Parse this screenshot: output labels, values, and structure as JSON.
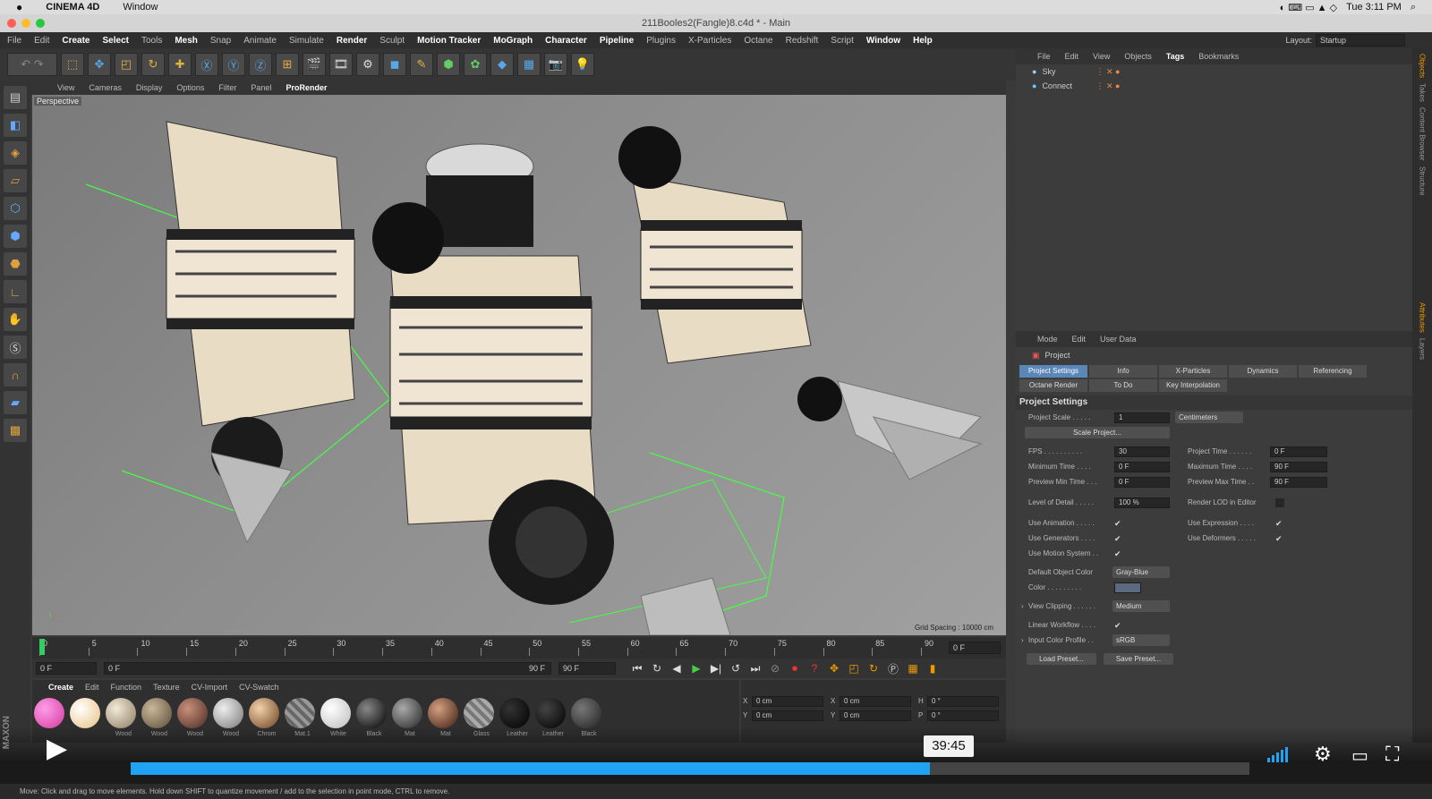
{
  "mac": {
    "apple": "",
    "app": "CINEMA 4D",
    "menu": "Window",
    "clock": "Tue 3:11 PM"
  },
  "window": {
    "title": "211Booles2(Fangle)8.c4d * - Main"
  },
  "menu": [
    "File",
    "Edit",
    "Create",
    "Select",
    "Tools",
    "Mesh",
    "Snap",
    "Animate",
    "Simulate",
    "Render",
    "Sculpt",
    "Motion Tracker",
    "MoGraph",
    "Character",
    "Pipeline",
    "Plugins",
    "X-Particles",
    "Octane",
    "Redshift",
    "Script",
    "Window",
    "Help"
  ],
  "menu_highlight": [
    "Create",
    "Select",
    "Mesh",
    "Render",
    "Motion Tracker",
    "MoGraph",
    "Character",
    "Pipeline",
    "Window",
    "Help"
  ],
  "layout": {
    "label": "Layout:",
    "value": "Startup"
  },
  "viewport": {
    "menu": [
      "View",
      "Cameras",
      "Display",
      "Options",
      "Filter",
      "Panel",
      "ProRender"
    ],
    "label": "Perspective",
    "grid_spacing": "Grid Spacing : 10000 cm"
  },
  "timeline": {
    "ticks": [
      "0",
      "5",
      "10",
      "15",
      "20",
      "25",
      "30",
      "35",
      "40",
      "45",
      "50",
      "55",
      "60",
      "65",
      "70",
      "75",
      "80",
      "85",
      "90"
    ],
    "end_field": "0 F"
  },
  "transport": {
    "start": "0 F",
    "range_start": "0 F",
    "range_end": "90 F",
    "end": "90 F"
  },
  "materials": {
    "menu": [
      "Create",
      "Edit",
      "Function",
      "Texture",
      "CV-Import",
      "CV-Swatch"
    ],
    "labels": [
      "Wood",
      "Wood",
      "Wood",
      "Wood",
      "Chrom",
      "Mat.1",
      "White",
      "Black",
      "Mat",
      "Mat",
      "Glass",
      "Leather",
      "Leather",
      "Black"
    ]
  },
  "coords": {
    "x_pos": "0 cm",
    "y_pos": "0 cm",
    "x_size": "0 cm",
    "y_size": "0 cm",
    "h_rot": "0 °",
    "p_rot": "0 °"
  },
  "objects": {
    "menu": [
      "File",
      "Edit",
      "View",
      "Objects",
      "Tags",
      "Bookmarks"
    ],
    "rows": [
      "Sky",
      "Connect"
    ]
  },
  "attributes": {
    "menu": [
      "Mode",
      "Edit",
      "User Data"
    ],
    "object": "Project",
    "tabs": [
      "Project Settings",
      "Info",
      "X-Particles",
      "Dynamics",
      "Referencing",
      "Octane Render",
      "To Do",
      "Key Interpolation"
    ],
    "section": "Project Settings",
    "project_scale_label": "Project Scale . . . . .",
    "project_scale_value": "1",
    "project_scale_unit": "Centimeters",
    "scale_project_btn": "Scale Project...",
    "fps_label": "FPS . . . . . . . . . .",
    "fps": "30",
    "project_time_label": "Project Time . . . . . .",
    "project_time": "0 F",
    "min_time_label": "Minimum Time . . . .",
    "min_time": "0 F",
    "max_time_label": "Maximum Time . . . .",
    "max_time": "90 F",
    "prev_min_label": "Preview Min Time . . .",
    "prev_min": "0 F",
    "prev_max_label": "Preview Max Time . .",
    "prev_max": "90 F",
    "lod_label": "Level of Detail . . . . .",
    "lod": "100 %",
    "render_lod_label": "Render LOD in Editor",
    "use_anim_label": "Use Animation . . . . .",
    "use_expr_label": "Use Expression . . . .",
    "use_gen_label": "Use Generators . . . .",
    "use_def_label": "Use Deformers . . . . .",
    "use_motion_label": "Use Motion System . .",
    "def_color_label": "Default Object Color",
    "def_color": "Gray-Blue",
    "color_label": "Color . . . . . . . . .",
    "view_clip_label": "View Clipping . . . . . .",
    "view_clip": "Medium",
    "linear_label": "Linear Workflow . . . .",
    "input_profile_label": "Input Color Profile . .",
    "input_profile": "sRGB",
    "load_preset": "Load Preset...",
    "save_preset": "Save Preset..."
  },
  "status": "Move: Click and drag to move elements. Hold down SHIFT to quantize movement / add to the selection in point mode, CTRL to remove.",
  "player": {
    "time": "39:45",
    "progress": 0.714
  },
  "icons": {
    "play": "play-icon",
    "volume": "volume-icon",
    "settings": "gear-icon",
    "pip": "pip-icon",
    "fullscreen": "fullscreen-icon"
  },
  "colors": {
    "accent": "#1fa3f2",
    "active_tab": "#5a86b8"
  }
}
